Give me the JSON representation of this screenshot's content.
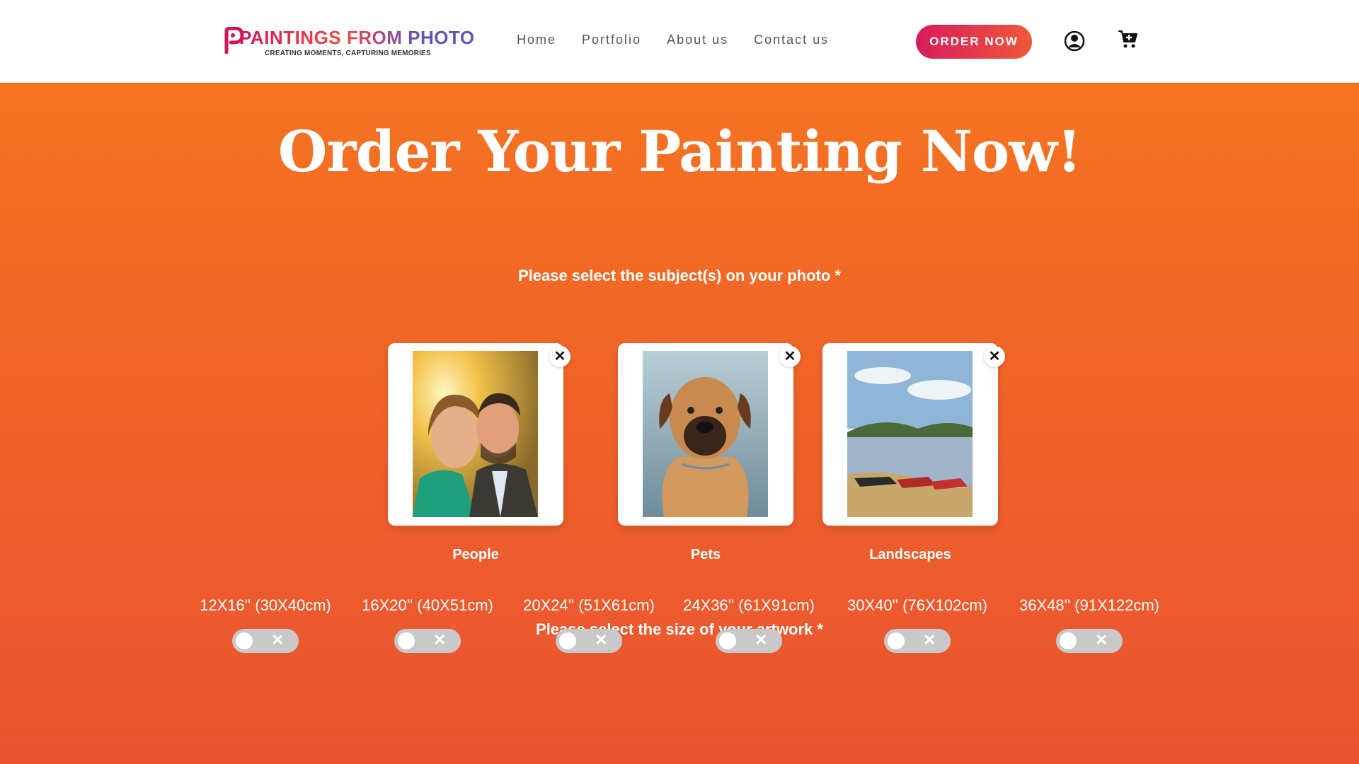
{
  "brand": {
    "name": "PAINTINGS FROM PHOTO",
    "tagline": "CREATING MOMENTS, CAPTURING MEMORIES"
  },
  "nav": {
    "items": [
      "Home",
      "Portfolio",
      "About us",
      "Contact us"
    ],
    "order_button": "ORDER NOW"
  },
  "hero": {
    "title": "Order Your Painting Now!",
    "subject_question": "Please select the subject(s) on your photo *",
    "size_question": "Please select the size of your artwork *"
  },
  "subjects": [
    {
      "label": "People",
      "close": "✕"
    },
    {
      "label": "Pets",
      "close": "✕"
    },
    {
      "label": "Landscapes",
      "close": "✕"
    }
  ],
  "sizes": [
    {
      "label": "12X16'' (30X40cm)",
      "toggle_off": "✕"
    },
    {
      "label": "16X20'' (40X51cm)",
      "toggle_off": "✕"
    },
    {
      "label": "20X24'' (51X61cm)",
      "toggle_off": "✕"
    },
    {
      "label": "24X36'' (61X91cm)",
      "toggle_off": "✕"
    },
    {
      "label": "30X40'' (76X102cm)",
      "toggle_off": "✕"
    },
    {
      "label": "36X48'' (91X122cm)",
      "toggle_off": "✕"
    }
  ],
  "colors": {
    "accent": "#ef4b3f",
    "hero_top": "#f57322",
    "hero_bottom": "#e95432"
  }
}
